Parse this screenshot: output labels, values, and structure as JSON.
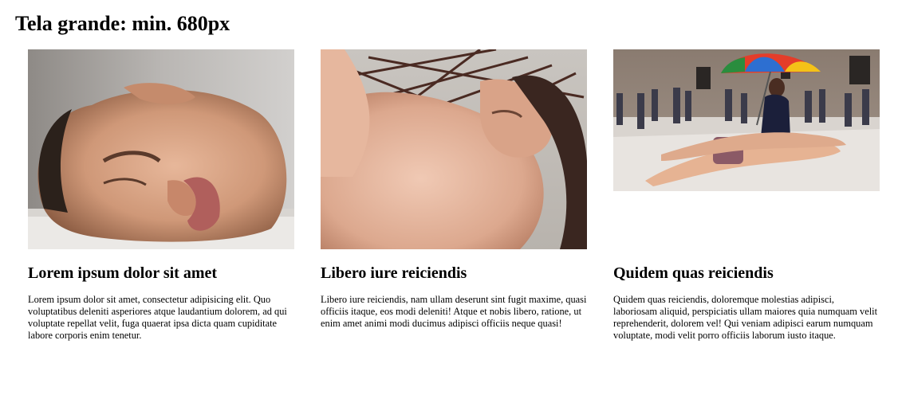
{
  "page": {
    "title": "Tela grande: min. 680px"
  },
  "cards": [
    {
      "image_subject": "sculpture of a sleeping face lying sideways",
      "title": "Lorem ipsum dolor sit amet",
      "text": "Lorem ipsum dolor sit amet, consectetur adipisicing elit. Quo voluptatibus deleniti asperiores atque laudantium dolorem, ad qui voluptate repellat velit, fuga quaerat ipsa dicta quam cupiditate labore corporis enim tenetur."
    },
    {
      "image_subject": "sculpture of a woman carrying a bundle of branches",
      "title": "Libero iure reiciendis",
      "text": "Libero iure reiciendis, nam ullam deserunt sint fugit maxime, quasi officiis itaque, eos modi deleniti! Atque et nobis libero, ratione, ut enim amet animi modi ducimus adipisci officiis neque quasi!"
    },
    {
      "image_subject": "sculpture of a couple lying under a colorful umbrella in a gallery",
      "title": "Quidem quas reiciendis",
      "text": "Quidem quas reiciendis, doloremque molestias adipisci, laboriosam aliquid, perspiciatis ullam maiores quia numquam velit reprehenderit, dolorem vel! Qui veniam adipisci earum numquam voluptate, modi velit porro officiis laborum iusto itaque."
    }
  ]
}
